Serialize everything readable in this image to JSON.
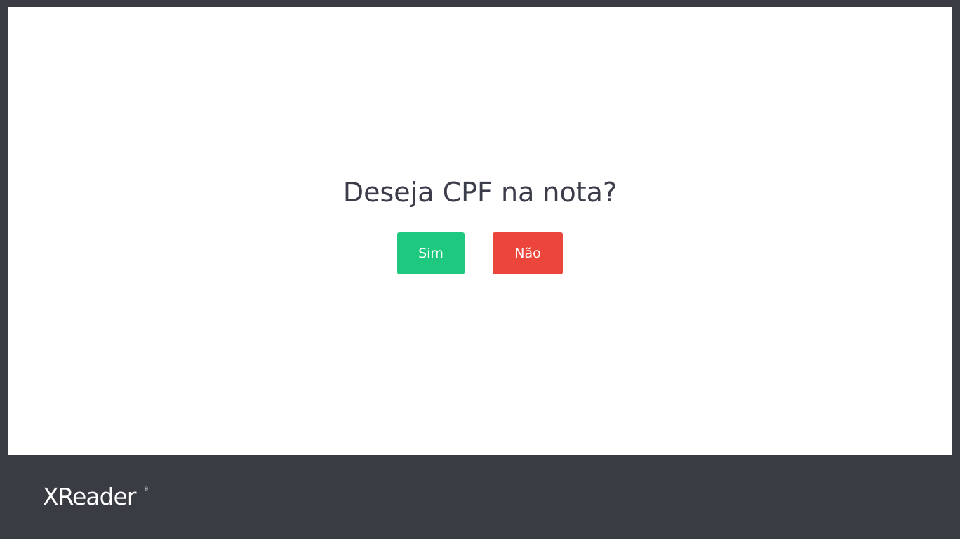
{
  "dialog": {
    "question": "Deseja CPF na nota?",
    "yes_label": "Sim",
    "no_label": "Não"
  },
  "footer": {
    "brand": "XReader",
    "registered_mark": "®"
  },
  "colors": {
    "background_dark": "#393c43",
    "panel": "#ffffff",
    "question_text": "#3c3d4a",
    "yes_button": "#1fc87f",
    "no_button": "#ec463c"
  }
}
